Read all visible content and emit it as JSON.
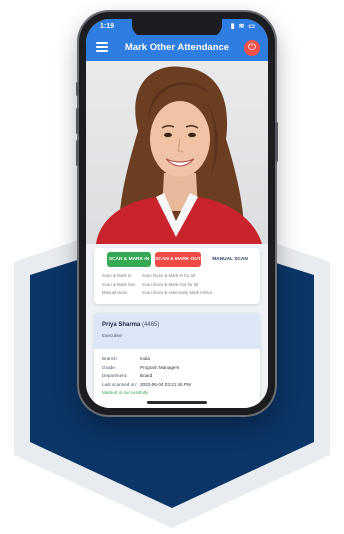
{
  "status_bar": {
    "time": "1:19",
    "icons": "▮ ≋ ▭"
  },
  "app_bar": {
    "title": "Mark Other Attendance"
  },
  "photo": {
    "subject": "Smiling woman in red blazer"
  },
  "scan_buttons": {
    "scan_mark_in": "SCAN & MARK IN",
    "scan_mark_out": "SCAN & MARK OUT",
    "manual_scan": "MANUAL SCAN"
  },
  "legend": [
    {
      "name": "Scan & Mark In",
      "desc": "Scan faces & Mark-In for all"
    },
    {
      "name": "Scan & Mark Out",
      "desc": "Scan faces & Mark-Out for all"
    },
    {
      "name": "Manual Scan",
      "desc": "Scan faces & selectively Mark In/Out"
    }
  ],
  "employee": {
    "name": "Priya  Sharma",
    "id": "(4465)",
    "designation": "Executive",
    "details": [
      {
        "label": "Branch:",
        "value": "India"
      },
      {
        "label": "Grade:",
        "value": "Program Managers"
      },
      {
        "label": "Department:",
        "value": "Board"
      },
      {
        "label": "Last scanned on:",
        "value": "2022-06-04 03:21:46 PM"
      }
    ],
    "status": "Marked in successfully"
  },
  "colors": {
    "primary": "#2f7de1",
    "green": "#35a853",
    "red": "#ef4a43",
    "navy_hex": "#0b3566",
    "light_hex": "#e8ebf0"
  },
  "icons": {
    "menu": "hamburger-menu-icon",
    "power": "power-icon"
  }
}
